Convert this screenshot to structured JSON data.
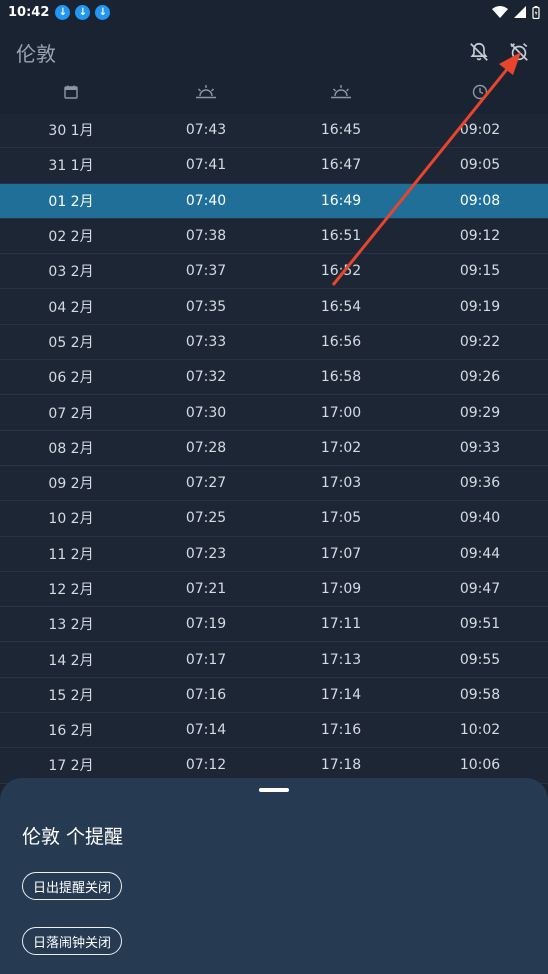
{
  "status_bar": {
    "time": "10:42"
  },
  "app_bar": {
    "title": "伦敦"
  },
  "icons": {
    "col_date": "calendar-icon",
    "col_sunrise": "sunrise-icon",
    "col_sunset": "sunset-icon",
    "col_daylength": "clock-icon",
    "bell_off": "bell-off-icon",
    "alarm_off": "alarm-off-icon"
  },
  "rows": [
    {
      "date": "30 1月",
      "sunrise": "07:43",
      "sunset": "16:45",
      "length": "09:02"
    },
    {
      "date": "31 1月",
      "sunrise": "07:41",
      "sunset": "16:47",
      "length": "09:05"
    },
    {
      "date": "01 2月",
      "sunrise": "07:40",
      "sunset": "16:49",
      "length": "09:08"
    },
    {
      "date": "02 2月",
      "sunrise": "07:38",
      "sunset": "16:51",
      "length": "09:12"
    },
    {
      "date": "03 2月",
      "sunrise": "07:37",
      "sunset": "16:52",
      "length": "09:15"
    },
    {
      "date": "04 2月",
      "sunrise": "07:35",
      "sunset": "16:54",
      "length": "09:19"
    },
    {
      "date": "05 2月",
      "sunrise": "07:33",
      "sunset": "16:56",
      "length": "09:22"
    },
    {
      "date": "06 2月",
      "sunrise": "07:32",
      "sunset": "16:58",
      "length": "09:26"
    },
    {
      "date": "07 2月",
      "sunrise": "07:30",
      "sunset": "17:00",
      "length": "09:29"
    },
    {
      "date": "08 2月",
      "sunrise": "07:28",
      "sunset": "17:02",
      "length": "09:33"
    },
    {
      "date": "09 2月",
      "sunrise": "07:27",
      "sunset": "17:03",
      "length": "09:36"
    },
    {
      "date": "10 2月",
      "sunrise": "07:25",
      "sunset": "17:05",
      "length": "09:40"
    },
    {
      "date": "11 2月",
      "sunrise": "07:23",
      "sunset": "17:07",
      "length": "09:44"
    },
    {
      "date": "12 2月",
      "sunrise": "07:21",
      "sunset": "17:09",
      "length": "09:47"
    },
    {
      "date": "13 2月",
      "sunrise": "07:19",
      "sunset": "17:11",
      "length": "09:51"
    },
    {
      "date": "14 2月",
      "sunrise": "07:17",
      "sunset": "17:13",
      "length": "09:55"
    },
    {
      "date": "15 2月",
      "sunrise": "07:16",
      "sunset": "17:14",
      "length": "09:58"
    },
    {
      "date": "16 2月",
      "sunrise": "07:14",
      "sunset": "17:16",
      "length": "10:02"
    },
    {
      "date": "17 2月",
      "sunrise": "07:12",
      "sunset": "17:18",
      "length": "10:06"
    }
  ],
  "highlight_row_index": 2,
  "bottom_sheet": {
    "title": "伦敦 个提醒",
    "sunrise_reminder": "日出提醒关闭",
    "sunset_alarm": "日落闹钟关闭"
  },
  "colors": {
    "background": "#1a2331",
    "highlight": "#1f6f98",
    "sheet": "#263a52",
    "annotation_arrow": "#e8452f"
  }
}
